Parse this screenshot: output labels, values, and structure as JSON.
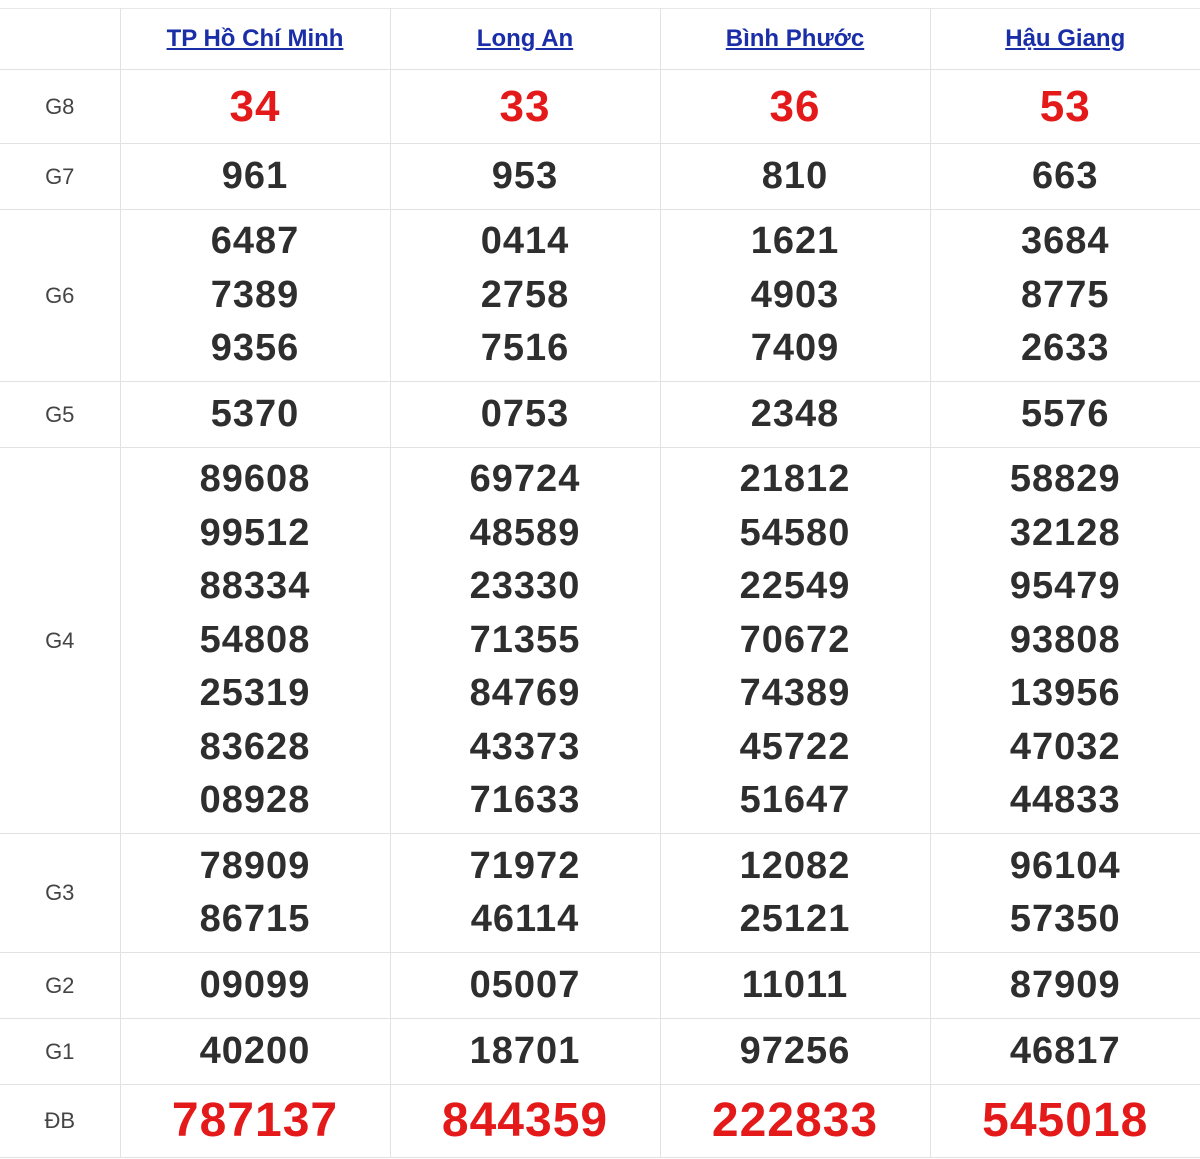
{
  "provinces": [
    "TP Hồ Chí Minh",
    "Long An",
    "Bình Phước",
    "Hậu Giang"
  ],
  "prizes": [
    {
      "label": "G8",
      "highlight": true,
      "values": [
        [
          "34"
        ],
        [
          "33"
        ],
        [
          "36"
        ],
        [
          "53"
        ]
      ]
    },
    {
      "label": "G7",
      "highlight": false,
      "values": [
        [
          "961"
        ],
        [
          "953"
        ],
        [
          "810"
        ],
        [
          "663"
        ]
      ]
    },
    {
      "label": "G6",
      "highlight": false,
      "values": [
        [
          "6487",
          "7389",
          "9356"
        ],
        [
          "0414",
          "2758",
          "7516"
        ],
        [
          "1621",
          "4903",
          "7409"
        ],
        [
          "3684",
          "8775",
          "2633"
        ]
      ]
    },
    {
      "label": "G5",
      "highlight": false,
      "values": [
        [
          "5370"
        ],
        [
          "0753"
        ],
        [
          "2348"
        ],
        [
          "5576"
        ]
      ]
    },
    {
      "label": "G4",
      "highlight": false,
      "values": [
        [
          "89608",
          "99512",
          "88334",
          "54808",
          "25319",
          "83628",
          "08928"
        ],
        [
          "69724",
          "48589",
          "23330",
          "71355",
          "84769",
          "43373",
          "71633"
        ],
        [
          "21812",
          "54580",
          "22549",
          "70672",
          "74389",
          "45722",
          "51647"
        ],
        [
          "58829",
          "32128",
          "95479",
          "93808",
          "13956",
          "47032",
          "44833"
        ]
      ]
    },
    {
      "label": "G3",
      "highlight": false,
      "values": [
        [
          "78909",
          "86715"
        ],
        [
          "71972",
          "46114"
        ],
        [
          "12082",
          "25121"
        ],
        [
          "96104",
          "57350"
        ]
      ]
    },
    {
      "label": "G2",
      "highlight": false,
      "values": [
        [
          "09099"
        ],
        [
          "05007"
        ],
        [
          "11011"
        ],
        [
          "87909"
        ]
      ]
    },
    {
      "label": "G1",
      "highlight": false,
      "values": [
        [
          "40200"
        ],
        [
          "18701"
        ],
        [
          "97256"
        ],
        [
          "46817"
        ]
      ]
    },
    {
      "label": "ĐB",
      "highlight": true,
      "values": [
        [
          "787137"
        ],
        [
          "844359"
        ],
        [
          "222833"
        ],
        [
          "545018"
        ]
      ]
    }
  ],
  "colors": {
    "highlight": "#e41a1a",
    "number": "#2e2e2e",
    "link": "#1a2ea8",
    "label": "#444444",
    "border": "#e2e2e2"
  }
}
